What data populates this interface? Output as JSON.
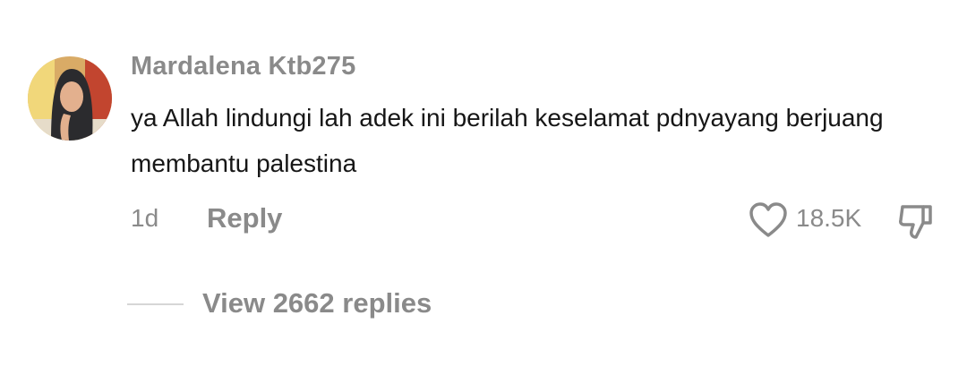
{
  "comment": {
    "username": "Mardalena Ktb275",
    "text": "ya Allah lindungi lah adek ini berilah keselamat pdnyayang berjuang membantu palestina",
    "time": "1d",
    "reply_label": "Reply",
    "like_count": "18.5K",
    "view_replies_label": "View 2662 replies",
    "icons": {
      "like": "heart-outline-icon",
      "dislike": "thumbs-down-icon"
    }
  },
  "colors": {
    "muted_text": "#8a8a8a",
    "body_text": "#161616",
    "divider": "#d6d6d6"
  }
}
